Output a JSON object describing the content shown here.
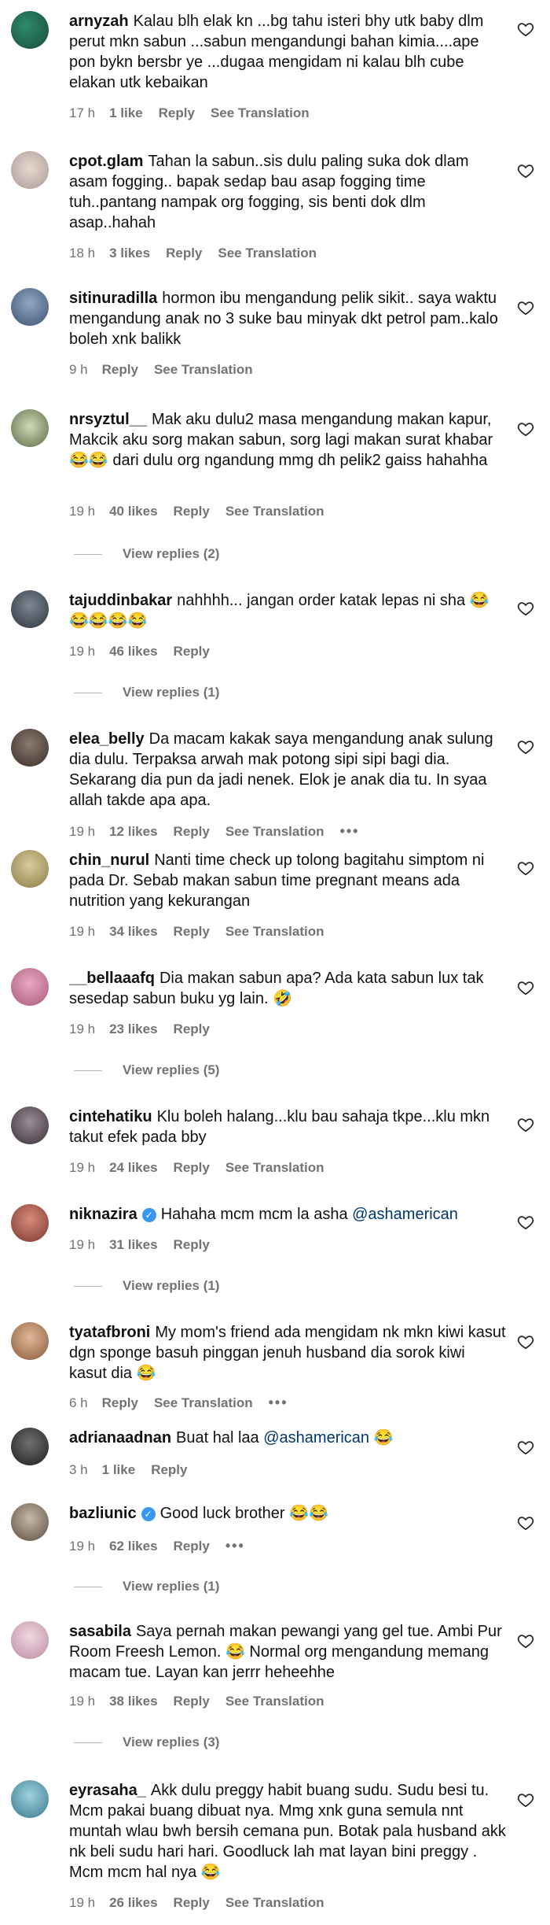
{
  "ui": {
    "reply_label": "Reply",
    "see_translation_label": "See Translation",
    "more_label": "•••"
  },
  "comments": [
    {
      "user": "arnyzah",
      "text": "Kalau blh elak kn ...bg tahu isteri bhy utk baby dlm perut mkn sabun ...sabun mengandungi bahan kimia....ape pon bykn bersbr ye ...dugaa mengidam ni kalau blh cube elakan utk kebaikan",
      "time": "17 h",
      "likes": "1 like",
      "translate": true
    },
    {
      "user": "cpot.glam",
      "text": "Tahan la sabun..sis dulu paling suka dok dlam asam fogging.. bapak sedap bau asap fogging time tuh..pantang nampak org fogging, sis benti dok dlm asap..hahah",
      "time": "18 h",
      "likes": "3 likes",
      "translate": true
    },
    {
      "user": "sitinuradilla",
      "text": "hormon ibu mengandung pelik sikit.. saya waktu mengandung anak no 3 suke bau minyak dkt petrol pam..kalo boleh xnk balikk",
      "time": "9 h",
      "likes": "",
      "translate": true
    },
    {
      "user": "nrsyztul__",
      "text": "Mak aku dulu2 masa mengandung makan kapur, Makcik aku sorg makan sabun, sorg lagi makan surat khabar 😂😂 dari dulu org ngandung mmg dh pelik2 gaiss hahahha",
      "time": "19 h",
      "likes": "40 likes",
      "translate": true,
      "replies": "View replies (2)"
    },
    {
      "user": "tajuddinbakar",
      "text": "nahhhh... jangan order katak lepas ni sha 😂😂😂😂😂",
      "time": "19 h",
      "likes": "46 likes",
      "translate": false,
      "replies": "View replies (1)"
    },
    {
      "user": "elea_belly",
      "text": "Da macam kakak saya mengandung anak sulung dia dulu. Terpaksa arwah mak potong sipi sipi bagi dia. Sekarang dia pun da jadi nenek. Elok je anak dia tu. In syaa allah takde apa apa.",
      "time": "19 h",
      "likes": "12 likes",
      "translate": true,
      "more": true
    },
    {
      "user": "chin_nurul",
      "text": "Nanti time check up tolong bagitahu simptom ni pada Dr. Sebab makan sabun time pregnant means ada nutrition yang kekurangan",
      "time": "19 h",
      "likes": "34 likes",
      "translate": true
    },
    {
      "user": "__bellaaafq",
      "text": "Dia makan sabun apa? Ada kata sabun lux tak sesedap sabun buku yg lain. 🤣",
      "time": "19 h",
      "likes": "23 likes",
      "translate": false,
      "replies": "View replies (5)"
    },
    {
      "user": "cintehatiku",
      "text": "Klu boleh halang...klu bau sahaja tkpe...klu mkn takut efek pada bby",
      "time": "19 h",
      "likes": "24 likes",
      "translate": true
    },
    {
      "user": "niknazira",
      "verified": true,
      "text": "Hahaha mcm mcm la asha ",
      "mention": "@ashamerican",
      "time": "19 h",
      "likes": "31 likes",
      "translate": false,
      "replies": "View replies (1)"
    },
    {
      "user": "tyatafbroni",
      "text": "My mom's friend ada mengidam nk mkn kiwi kasut dgn sponge basuh pinggan jenuh husband dia sorok kiwi kasut dia 😂",
      "time": "6 h",
      "likes": "",
      "translate": true,
      "more": true
    },
    {
      "user": "adrianaadnan",
      "text": "Buat hal laa ",
      "mention": "@ashamerican",
      "after": " 😂",
      "time": "3 h",
      "likes": "1 like",
      "translate": false
    },
    {
      "user": "bazliunic",
      "verified": true,
      "text": "Good luck brother 😂😂",
      "time": "19 h",
      "likes": "62 likes",
      "translate": false,
      "more": true,
      "replies": "View replies (1)"
    },
    {
      "user": "sasabila",
      "text": "Saya pernah makan pewangi yang gel tue. Ambi Pur Room Freesh Lemon. 😂 Normal org mengandung memang macam tue. Layan kan jerrr heheehhe",
      "time": "19 h",
      "likes": "38 likes",
      "translate": true,
      "replies": "View replies (3)"
    },
    {
      "user": "eyrasaha_",
      "text": "Akk dulu preggy habit buang sudu. Sudu besi tu. Mcm pakai buang dibuat nya. Mmg xnk guna semula nnt muntah wlau bwh bersih cemana pun. Botak pala husband akk nk beli sudu hari hari. Goodluck lah mat layan bini preggy . Mcm mcm hal nya 😂",
      "time": "19 h",
      "likes": "26 likes",
      "translate": true
    }
  ]
}
